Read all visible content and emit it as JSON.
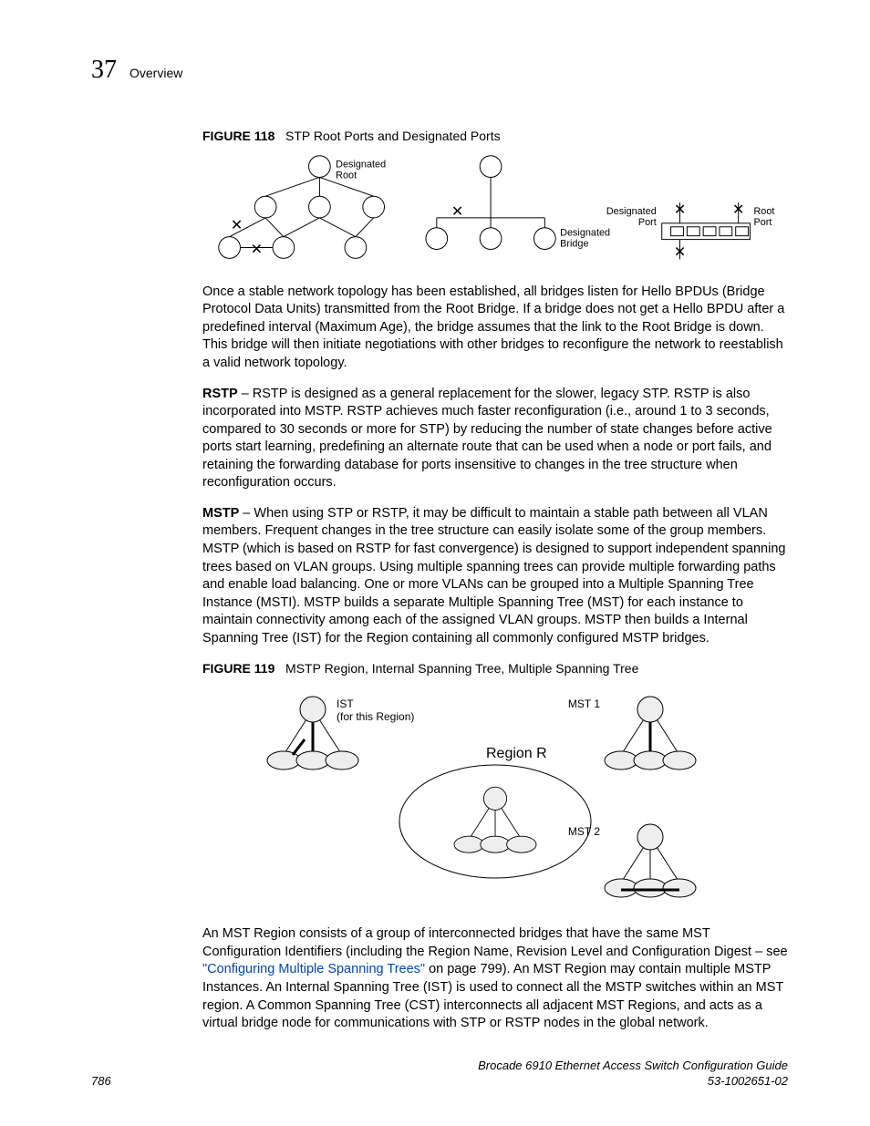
{
  "header": {
    "chapter": "37",
    "section": "Overview"
  },
  "fig118": {
    "label": "FIGURE 118",
    "caption": "STP Root Ports and Designated Ports",
    "labels": {
      "desig_root1": "Designated",
      "desig_root2": "Root",
      "desig_bridge1": "Designated",
      "desig_bridge2": "Bridge",
      "desig_port1": "Designated",
      "desig_port2": "Port",
      "root_port1": "Root",
      "root_port2": "Port"
    }
  },
  "para1": "Once a stable network topology has been established, all bridges listen for Hello BPDUs (Bridge Protocol Data Units) transmitted from the Root Bridge. If a bridge does not get a Hello BPDU after a predefined interval (Maximum Age), the bridge assumes that the link to the Root Bridge is down. This bridge will then initiate negotiations with other bridges to reconfigure the network to reestablish a valid network topology.",
  "rstp": {
    "runin": "RSTP",
    "text": " – RSTP is designed as a general replacement for the slower, legacy STP. RSTP is also incorporated into MSTP. RSTP achieves much faster reconfiguration (i.e., around 1 to 3 seconds, compared to 30 seconds or more for STP) by reducing the number of state changes before active ports start learning, predefining an alternate route that can be used when a node or port fails, and retaining the forwarding database for ports insensitive to changes in the tree structure when reconfiguration occurs."
  },
  "mstp": {
    "runin": "MSTP",
    "text": " – When using STP or RSTP, it may be difficult to maintain a stable path between all VLAN members. Frequent changes in the tree structure can easily isolate some of the group members. MSTP (which is based on RSTP for fast convergence) is designed to support independent spanning trees based on VLAN groups. Using multiple spanning trees can provide multiple forwarding paths and enable load balancing. One or more VLANs can be grouped into a Multiple Spanning Tree Instance (MSTI). MSTP builds a separate Multiple Spanning Tree (MST) for each instance to maintain connectivity among each of the assigned VLAN groups. MSTP then builds a Internal Spanning Tree (IST) for the Region containing all commonly configured MSTP bridges."
  },
  "fig119": {
    "label": "FIGURE 119",
    "caption": "MSTP Region, Internal Spanning Tree, Multiple Spanning Tree",
    "labels": {
      "ist1": "IST",
      "ist2": "(for this Region)",
      "region": "Region R",
      "mst1": "MST 1",
      "mst2": "MST 2"
    }
  },
  "para2a": "An MST Region consists of a group of interconnected bridges that have the same MST Configuration Identifiers (including the Region Name, Revision Level and Configuration Digest – see ",
  "link": "\"Configuring Multiple Spanning Trees\"",
  "para2b": " on page 799). An MST Region may contain multiple MSTP Instances. An Internal Spanning Tree (IST) is used to connect all the MSTP switches within an MST region. A Common Spanning Tree (CST) interconnects all adjacent MST Regions, and acts as a virtual bridge node for communications with STP or RSTP nodes in the global network.",
  "footer": {
    "page": "786",
    "doc": "Brocade 6910 Ethernet Access Switch Configuration Guide",
    "num": "53-1002651-02"
  }
}
